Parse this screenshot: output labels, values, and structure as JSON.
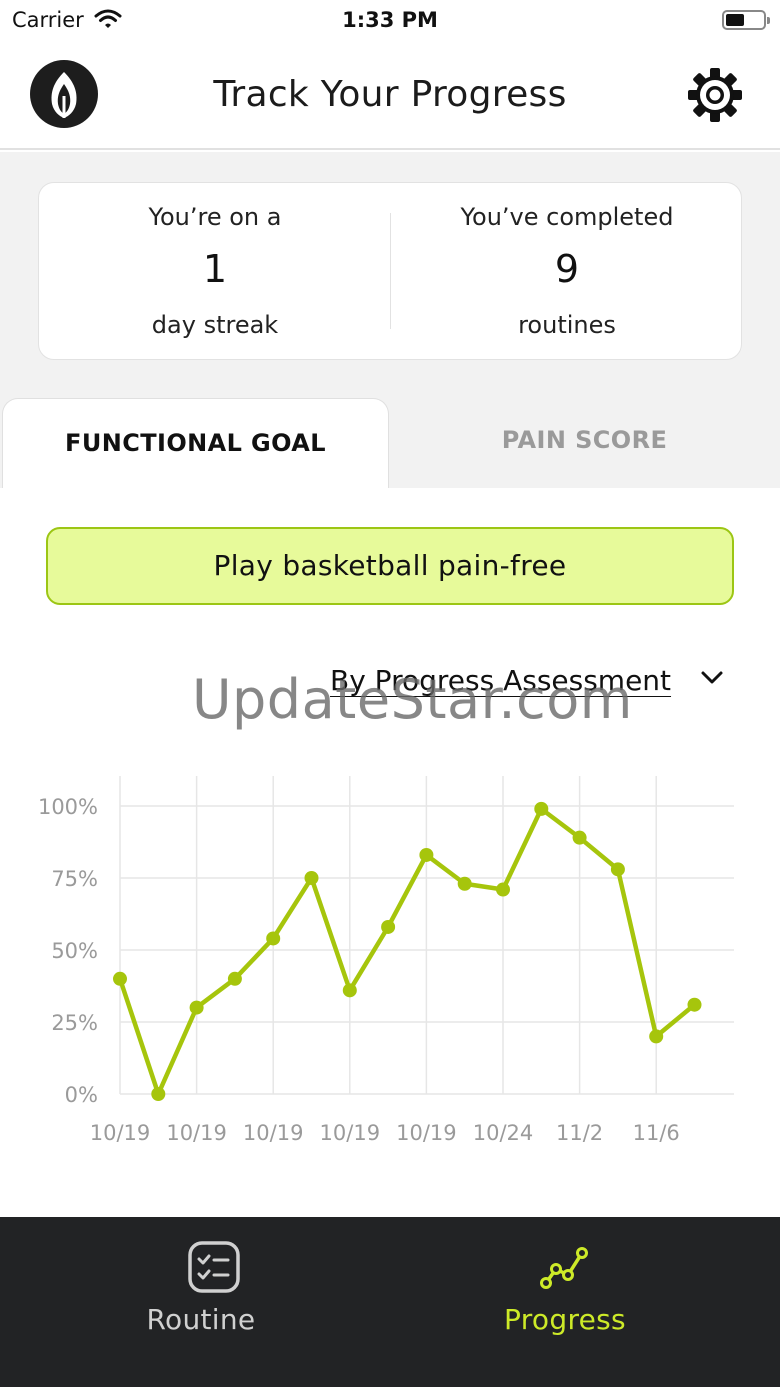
{
  "status_bar": {
    "carrier": "Carrier",
    "time": "1:33 PM"
  },
  "header": {
    "title": "Track Your Progress"
  },
  "stats": {
    "streak": {
      "prefix": "You’re on a",
      "value": "1",
      "suffix": "day streak"
    },
    "completed": {
      "prefix": "You’ve completed",
      "value": "9",
      "suffix": "routines"
    }
  },
  "tabs": [
    {
      "label": "FUNCTIONAL GOAL",
      "active": true
    },
    {
      "label": "PAIN SCORE",
      "active": false
    }
  ],
  "goal": {
    "label": "Play basketball pain-free"
  },
  "filter": {
    "selected": "By Progress Assessment"
  },
  "watermark": "UpdateStar.com",
  "colors": {
    "accent": "#a6c50c",
    "goal_bg": "#e7fa9a",
    "active_tab_text": "#cdea28",
    "tabbar_bg": "#222325"
  },
  "chart_data": {
    "type": "line",
    "y_ticks": [
      "100%",
      "75%",
      "50%",
      "25%",
      "0%"
    ],
    "x_tick_labels": [
      "10/19",
      "10/19",
      "10/19",
      "10/19",
      "10/19",
      "10/24",
      "11/2",
      "11/6"
    ],
    "ylim": [
      0,
      100
    ],
    "grid": true,
    "series": [
      {
        "values": [
          40,
          0,
          30,
          40,
          54,
          75,
          36,
          58,
          83,
          73,
          71,
          99,
          89,
          78,
          20,
          31
        ]
      }
    ]
  },
  "bottom_nav": [
    {
      "label": "Routine",
      "icon": "checklist-icon",
      "active": false
    },
    {
      "label": "Progress",
      "icon": "progress-chart-icon",
      "active": true
    }
  ]
}
